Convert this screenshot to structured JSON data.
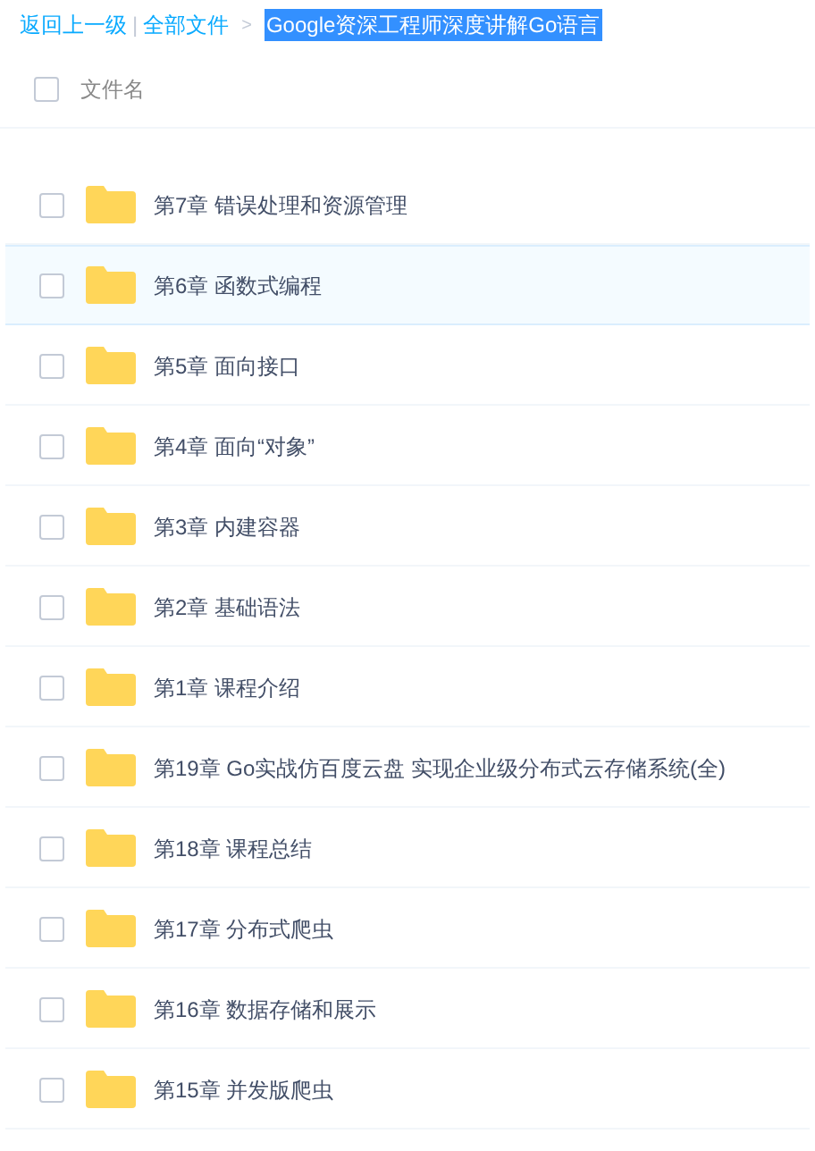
{
  "breadcrumb": {
    "back": "返回上一级",
    "separator": "|",
    "root": "全部文件",
    "arrow": ">",
    "current": "Google资深工程师深度讲解Go语言"
  },
  "table": {
    "header": {
      "label": "文件名",
      "checked": false
    },
    "rows": [
      {
        "name": "第7章 错误处理和资源管理",
        "checked": false,
        "selected": false
      },
      {
        "name": "第6章 函数式编程",
        "checked": false,
        "selected": true
      },
      {
        "name": "第5章 面向接口",
        "checked": false,
        "selected": false
      },
      {
        "name": "第4章 面向“对象”",
        "checked": false,
        "selected": false
      },
      {
        "name": "第3章 内建容器",
        "checked": false,
        "selected": false
      },
      {
        "name": "第2章 基础语法",
        "checked": false,
        "selected": false
      },
      {
        "name": "第1章 课程介绍",
        "checked": false,
        "selected": false
      },
      {
        "name": "第19章 Go实战仿百度云盘 实现企业级分布式云存储系统(全)",
        "checked": false,
        "selected": false
      },
      {
        "name": "第18章 课程总结",
        "checked": false,
        "selected": false
      },
      {
        "name": "第17章 分布式爬虫",
        "checked": false,
        "selected": false
      },
      {
        "name": "第16章 数据存储和展示",
        "checked": false,
        "selected": false
      },
      {
        "name": "第15章 并发版爬虫",
        "checked": false,
        "selected": false
      }
    ]
  }
}
